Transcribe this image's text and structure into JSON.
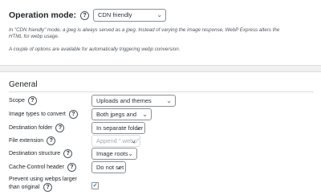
{
  "operation_mode": {
    "label": "Operation mode:",
    "value": "CDN friendly",
    "description": "In \"CDN friendly\" mode, a jpeg is always served as a jpeg. Instead of varying the image response, WebP Express alters the HTML for webp usage.",
    "note": "A couple of options are available for automatically triggering webp conversion."
  },
  "general": {
    "title": "General",
    "rows": [
      {
        "label": "Scope",
        "value": "Uploads and themes"
      },
      {
        "label": "Image types to convert",
        "value": "Both jpegs and pngs"
      },
      {
        "label": "Destination folder",
        "value": "In separate folder"
      },
      {
        "label": "File extension",
        "value": "Append \".webp\""
      },
      {
        "label": "Destination structure",
        "value": "Image roots"
      },
      {
        "label": "Cache-Control header",
        "value": "Do not set"
      }
    ],
    "prevent_larger": {
      "label_line1": "Prevent using webps larger",
      "label_line2": "than original",
      "checked": true,
      "check_glyph": "✓"
    }
  },
  "icons": {
    "help": "?",
    "chevron": "⌄"
  },
  "colors": {
    "page_bg": "#f0f0f1",
    "panel_bg": "#ffffff",
    "accent": "#2271b1"
  }
}
